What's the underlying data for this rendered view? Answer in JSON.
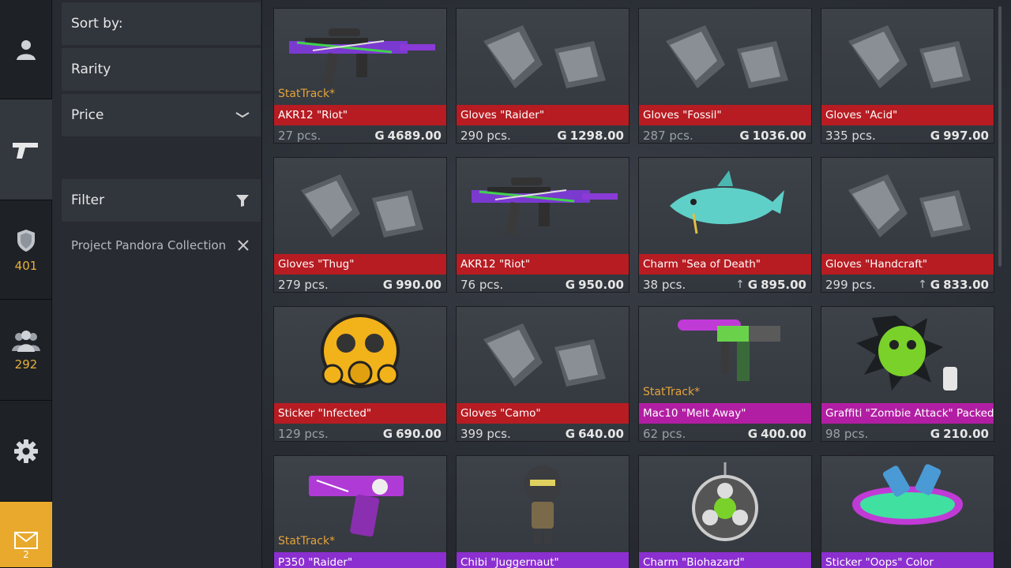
{
  "rail": {
    "items": [
      {
        "icon": "profile-icon",
        "count": ""
      },
      {
        "icon": "pistol-icon",
        "count": ""
      },
      {
        "icon": "rank-shield-icon",
        "count": "401"
      },
      {
        "icon": "friends-icon",
        "count": "292"
      },
      {
        "icon": "gear-icon",
        "count": ""
      },
      {
        "icon": "mail-icon",
        "count": "2"
      }
    ]
  },
  "panel": {
    "sort_by": "Sort by:",
    "rarity": "Rarity",
    "price": "Price",
    "filter": "Filter",
    "collection_chip": "Project Pandora Collection"
  },
  "colors": {
    "accent": "#e8b13b",
    "red": "#b71c22",
    "magenta": "#b21ea3",
    "purple": "#8c2fd0"
  },
  "currency_symbol": "G",
  "stattrack_label": "StatTrack*",
  "items": [
    {
      "name": "AKR12 \"Riot\"",
      "pcs": "27 pcs.",
      "price": "4689.00",
      "stattrack": true,
      "rarity": "red",
      "icon": "rifle-icon",
      "dim": true,
      "up": false
    },
    {
      "name": "Gloves \"Raider\"",
      "pcs": "290 pcs.",
      "price": "1298.00",
      "stattrack": false,
      "rarity": "red",
      "icon": "gloves-icon",
      "dim": false,
      "up": false
    },
    {
      "name": "Gloves \"Fossil\"",
      "pcs": "287 pcs.",
      "price": "1036.00",
      "stattrack": false,
      "rarity": "red",
      "icon": "gloves-icon",
      "dim": true,
      "up": false
    },
    {
      "name": "Gloves \"Acid\"",
      "pcs": "335 pcs.",
      "price": "997.00",
      "stattrack": false,
      "rarity": "red",
      "icon": "gloves-icon",
      "dim": false,
      "up": false
    },
    {
      "name": "Gloves \"Thug\"",
      "pcs": "279 pcs.",
      "price": "990.00",
      "stattrack": false,
      "rarity": "red",
      "icon": "gloves-icon",
      "dim": false,
      "up": false
    },
    {
      "name": "AKR12 \"Riot\"",
      "pcs": "76 pcs.",
      "price": "950.00",
      "stattrack": false,
      "rarity": "red",
      "icon": "rifle-icon",
      "dim": false,
      "up": false
    },
    {
      "name": "Charm \"Sea of Death\"",
      "pcs": "38 pcs.",
      "price": "895.00",
      "stattrack": false,
      "rarity": "red",
      "icon": "shark-charm-icon",
      "dim": false,
      "up": true
    },
    {
      "name": "Gloves \"Handcraft\"",
      "pcs": "299 pcs.",
      "price": "833.00",
      "stattrack": false,
      "rarity": "red",
      "icon": "gloves-icon",
      "dim": false,
      "up": true
    },
    {
      "name": "Sticker \"Infected\"",
      "pcs": "129 pcs.",
      "price": "690.00",
      "stattrack": false,
      "rarity": "red",
      "icon": "gasmask-sticker-icon",
      "dim": true,
      "up": false
    },
    {
      "name": "Gloves \"Camo\"",
      "pcs": "399 pcs.",
      "price": "640.00",
      "stattrack": false,
      "rarity": "red",
      "icon": "gloves-icon",
      "dim": false,
      "up": false
    },
    {
      "name": "Mac10 \"Melt Away\"",
      "pcs": "62 pcs.",
      "price": "400.00",
      "stattrack": true,
      "rarity": "magenta",
      "icon": "smg-icon",
      "dim": true,
      "up": false
    },
    {
      "name": "Graffiti \"Zombie Attack\" Packed",
      "pcs": "98 pcs.",
      "price": "210.00",
      "stattrack": false,
      "rarity": "magenta",
      "icon": "zombie-graffiti-icon",
      "dim": true,
      "up": false
    },
    {
      "name": "P350 \"Raider\"",
      "pcs": "",
      "price": "",
      "stattrack": true,
      "rarity": "purple",
      "icon": "pistol-skin-icon",
      "dim": false,
      "up": false
    },
    {
      "name": "Chibi \"Juggernaut\"",
      "pcs": "",
      "price": "",
      "stattrack": false,
      "rarity": "purple",
      "icon": "chibi-icon",
      "dim": false,
      "up": false
    },
    {
      "name": "Charm \"Biohazard\"",
      "pcs": "",
      "price": "",
      "stattrack": false,
      "rarity": "purple",
      "icon": "biohazard-charm-icon",
      "dim": false,
      "up": false
    },
    {
      "name": "Sticker \"Oops\" Color",
      "pcs": "",
      "price": "",
      "stattrack": false,
      "rarity": "purple",
      "icon": "oops-sticker-icon",
      "dim": false,
      "up": false
    }
  ]
}
